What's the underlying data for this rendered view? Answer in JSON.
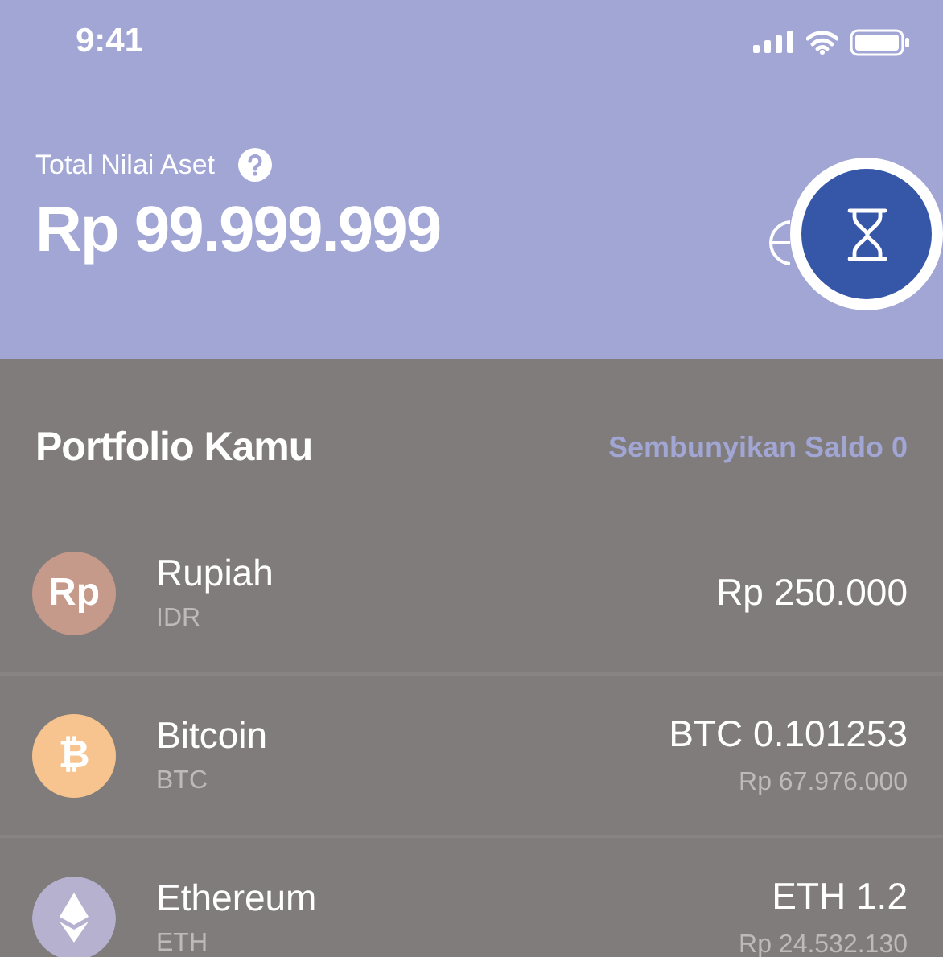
{
  "status_bar": {
    "time": "9:41"
  },
  "header": {
    "label": "Total Nilai Aset",
    "total": "Rp 99.999.999"
  },
  "portfolio": {
    "title": "Portfolio Kamu",
    "action": "Sembunyikan Saldo 0",
    "assets": [
      {
        "name": "Rupiah",
        "code": "IDR",
        "amount": "Rp 250.000",
        "kind": "text",
        "symbol": "Rp",
        "color": "#c59a8b"
      },
      {
        "name": "Bitcoin",
        "code": "BTC",
        "amount": "BTC 0.101253",
        "value": "Rp 67.976.000",
        "kind": "text",
        "symbol": "₿",
        "color": "#f7c48f"
      },
      {
        "name": "Ethereum",
        "code": "ETH",
        "amount": "ETH 1.2",
        "value": "Rp 24.532.130",
        "kind": "eth",
        "color": "#b5b1cf"
      }
    ]
  }
}
